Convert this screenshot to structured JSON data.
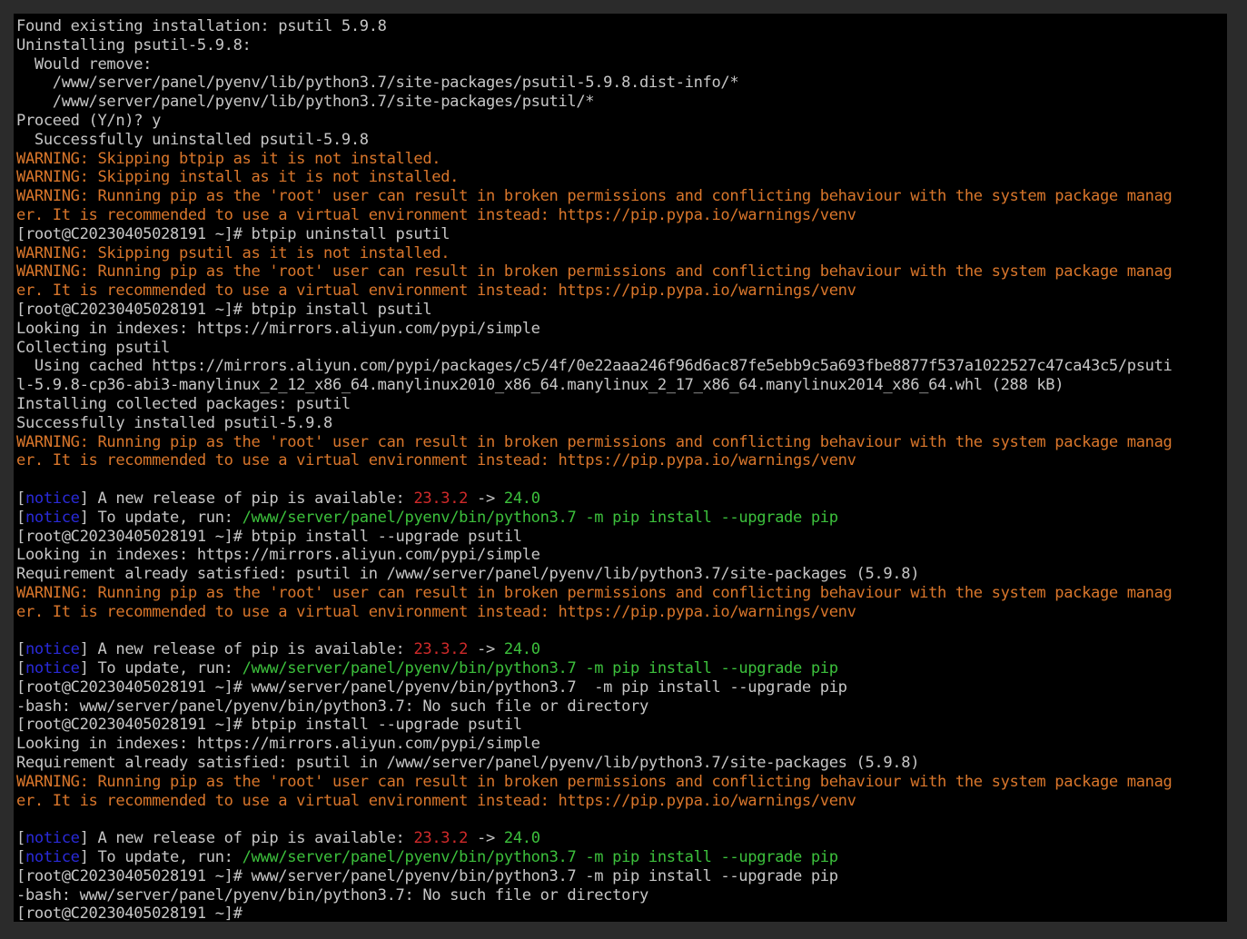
{
  "colors": {
    "window_bg": "#2b2b2b",
    "terminal_bg": "#000000",
    "default_text": "#c6c6c6",
    "warning": "#d9762b",
    "notice": "#2a2ad8",
    "old_version": "#d02a2a",
    "new_version_command": "#3cc03c"
  },
  "terminal": {
    "lines": [
      {
        "segments": [
          {
            "t": "Found existing installation: psutil 5.9.8",
            "c": "default"
          }
        ]
      },
      {
        "segments": [
          {
            "t": "Uninstalling psutil-5.9.8:",
            "c": "default"
          }
        ]
      },
      {
        "segments": [
          {
            "t": "  Would remove:",
            "c": "default"
          }
        ]
      },
      {
        "segments": [
          {
            "t": "    /www/server/panel/pyenv/lib/python3.7/site-packages/psutil-5.9.8.dist-info/*",
            "c": "default"
          }
        ]
      },
      {
        "segments": [
          {
            "t": "    /www/server/panel/pyenv/lib/python3.7/site-packages/psutil/*",
            "c": "default"
          }
        ]
      },
      {
        "segments": [
          {
            "t": "Proceed (Y/n)? y",
            "c": "default"
          }
        ]
      },
      {
        "segments": [
          {
            "t": "  Successfully uninstalled psutil-5.9.8",
            "c": "default"
          }
        ]
      },
      {
        "segments": [
          {
            "t": "WARNING: Skipping btpip as it is not installed.",
            "c": "warn"
          }
        ]
      },
      {
        "segments": [
          {
            "t": "WARNING: Skipping install as it is not installed.",
            "c": "warn"
          }
        ]
      },
      {
        "segments": [
          {
            "t": "WARNING: Running pip as the 'root' user can result in broken permissions and conflicting behaviour with the system package manag",
            "c": "warn"
          }
        ]
      },
      {
        "segments": [
          {
            "t": "er. It is recommended to use a virtual environment instead: https://pip.pypa.io/warnings/venv",
            "c": "warn"
          }
        ]
      },
      {
        "segments": [
          {
            "t": "[root@C20230405028191 ~]# btpip uninstall psutil",
            "c": "default"
          }
        ]
      },
      {
        "segments": [
          {
            "t": "WARNING: Skipping psutil as it is not installed.",
            "c": "warn"
          }
        ]
      },
      {
        "segments": [
          {
            "t": "WARNING: Running pip as the 'root' user can result in broken permissions and conflicting behaviour with the system package manag",
            "c": "warn"
          }
        ]
      },
      {
        "segments": [
          {
            "t": "er. It is recommended to use a virtual environment instead: https://pip.pypa.io/warnings/venv",
            "c": "warn"
          }
        ]
      },
      {
        "segments": [
          {
            "t": "[root@C20230405028191 ~]# btpip install psutil",
            "c": "default"
          }
        ]
      },
      {
        "segments": [
          {
            "t": "Looking in indexes: https://mirrors.aliyun.com/pypi/simple",
            "c": "default"
          }
        ]
      },
      {
        "segments": [
          {
            "t": "Collecting psutil",
            "c": "default"
          }
        ]
      },
      {
        "segments": [
          {
            "t": "  Using cached https://mirrors.aliyun.com/pypi/packages/c5/4f/0e22aaa246f96d6ac87fe5ebb9c5a693fbe8877f537a1022527c47ca43c5/psuti",
            "c": "default"
          }
        ]
      },
      {
        "segments": [
          {
            "t": "l-5.9.8-cp36-abi3-manylinux_2_12_x86_64.manylinux2010_x86_64.manylinux_2_17_x86_64.manylinux2014_x86_64.whl (288 kB)",
            "c": "default"
          }
        ]
      },
      {
        "segments": [
          {
            "t": "Installing collected packages: psutil",
            "c": "default"
          }
        ]
      },
      {
        "segments": [
          {
            "t": "Successfully installed psutil-5.9.8",
            "c": "default"
          }
        ]
      },
      {
        "segments": [
          {
            "t": "WARNING: Running pip as the 'root' user can result in broken permissions and conflicting behaviour with the system package manag",
            "c": "warn"
          }
        ]
      },
      {
        "segments": [
          {
            "t": "er. It is recommended to use a virtual environment instead: https://pip.pypa.io/warnings/venv",
            "c": "warn"
          }
        ]
      },
      {
        "segments": [
          {
            "t": "",
            "c": "default"
          }
        ]
      },
      {
        "segments": [
          {
            "t": "[",
            "c": "default"
          },
          {
            "t": "notice",
            "c": "notice"
          },
          {
            "t": "] A new release of pip is available: ",
            "c": "default"
          },
          {
            "t": "23.3.2",
            "c": "red"
          },
          {
            "t": " -> ",
            "c": "default"
          },
          {
            "t": "24.0",
            "c": "green"
          }
        ]
      },
      {
        "segments": [
          {
            "t": "[",
            "c": "default"
          },
          {
            "t": "notice",
            "c": "notice"
          },
          {
            "t": "] To update, run: ",
            "c": "default"
          },
          {
            "t": "/www/server/panel/pyenv/bin/python3.7 -m pip install --upgrade pip",
            "c": "green"
          }
        ]
      },
      {
        "segments": [
          {
            "t": "[root@C20230405028191 ~]# btpip install --upgrade psutil",
            "c": "default"
          }
        ]
      },
      {
        "segments": [
          {
            "t": "Looking in indexes: https://mirrors.aliyun.com/pypi/simple",
            "c": "default"
          }
        ]
      },
      {
        "segments": [
          {
            "t": "Requirement already satisfied: psutil in /www/server/panel/pyenv/lib/python3.7/site-packages (5.9.8)",
            "c": "default"
          }
        ]
      },
      {
        "segments": [
          {
            "t": "WARNING: Running pip as the 'root' user can result in broken permissions and conflicting behaviour with the system package manag",
            "c": "warn"
          }
        ]
      },
      {
        "segments": [
          {
            "t": "er. It is recommended to use a virtual environment instead: https://pip.pypa.io/warnings/venv",
            "c": "warn"
          }
        ]
      },
      {
        "segments": [
          {
            "t": "",
            "c": "default"
          }
        ]
      },
      {
        "segments": [
          {
            "t": "[",
            "c": "default"
          },
          {
            "t": "notice",
            "c": "notice"
          },
          {
            "t": "] A new release of pip is available: ",
            "c": "default"
          },
          {
            "t": "23.3.2",
            "c": "red"
          },
          {
            "t": " -> ",
            "c": "default"
          },
          {
            "t": "24.0",
            "c": "green"
          }
        ]
      },
      {
        "segments": [
          {
            "t": "[",
            "c": "default"
          },
          {
            "t": "notice",
            "c": "notice"
          },
          {
            "t": "] To update, run: ",
            "c": "default"
          },
          {
            "t": "/www/server/panel/pyenv/bin/python3.7 -m pip install --upgrade pip",
            "c": "green"
          }
        ]
      },
      {
        "segments": [
          {
            "t": "[root@C20230405028191 ~]# www/server/panel/pyenv/bin/python3.7  -m pip install --upgrade pip",
            "c": "default"
          }
        ]
      },
      {
        "segments": [
          {
            "t": "-bash: www/server/panel/pyenv/bin/python3.7: No such file or directory",
            "c": "default"
          }
        ]
      },
      {
        "segments": [
          {
            "t": "[root@C20230405028191 ~]# btpip install --upgrade psutil",
            "c": "default"
          }
        ]
      },
      {
        "segments": [
          {
            "t": "Looking in indexes: https://mirrors.aliyun.com/pypi/simple",
            "c": "default"
          }
        ]
      },
      {
        "segments": [
          {
            "t": "Requirement already satisfied: psutil in /www/server/panel/pyenv/lib/python3.7/site-packages (5.9.8)",
            "c": "default"
          }
        ]
      },
      {
        "segments": [
          {
            "t": "WARNING: Running pip as the 'root' user can result in broken permissions and conflicting behaviour with the system package manag",
            "c": "warn"
          }
        ]
      },
      {
        "segments": [
          {
            "t": "er. It is recommended to use a virtual environment instead: https://pip.pypa.io/warnings/venv",
            "c": "warn"
          }
        ]
      },
      {
        "segments": [
          {
            "t": "",
            "c": "default"
          }
        ]
      },
      {
        "segments": [
          {
            "t": "[",
            "c": "default"
          },
          {
            "t": "notice",
            "c": "notice"
          },
          {
            "t": "] A new release of pip is available: ",
            "c": "default"
          },
          {
            "t": "23.3.2",
            "c": "red"
          },
          {
            "t": " -> ",
            "c": "default"
          },
          {
            "t": "24.0",
            "c": "green"
          }
        ]
      },
      {
        "segments": [
          {
            "t": "[",
            "c": "default"
          },
          {
            "t": "notice",
            "c": "notice"
          },
          {
            "t": "] To update, run: ",
            "c": "default"
          },
          {
            "t": "/www/server/panel/pyenv/bin/python3.7 -m pip install --upgrade pip",
            "c": "green"
          }
        ]
      },
      {
        "segments": [
          {
            "t": "[root@C20230405028191 ~]# www/server/panel/pyenv/bin/python3.7 -m pip install --upgrade pip",
            "c": "default"
          }
        ]
      },
      {
        "segments": [
          {
            "t": "-bash: www/server/panel/pyenv/bin/python3.7: No such file or directory",
            "c": "default"
          }
        ]
      },
      {
        "segments": [
          {
            "t": "[root@C20230405028191 ~]#",
            "c": "default"
          }
        ]
      }
    ]
  }
}
